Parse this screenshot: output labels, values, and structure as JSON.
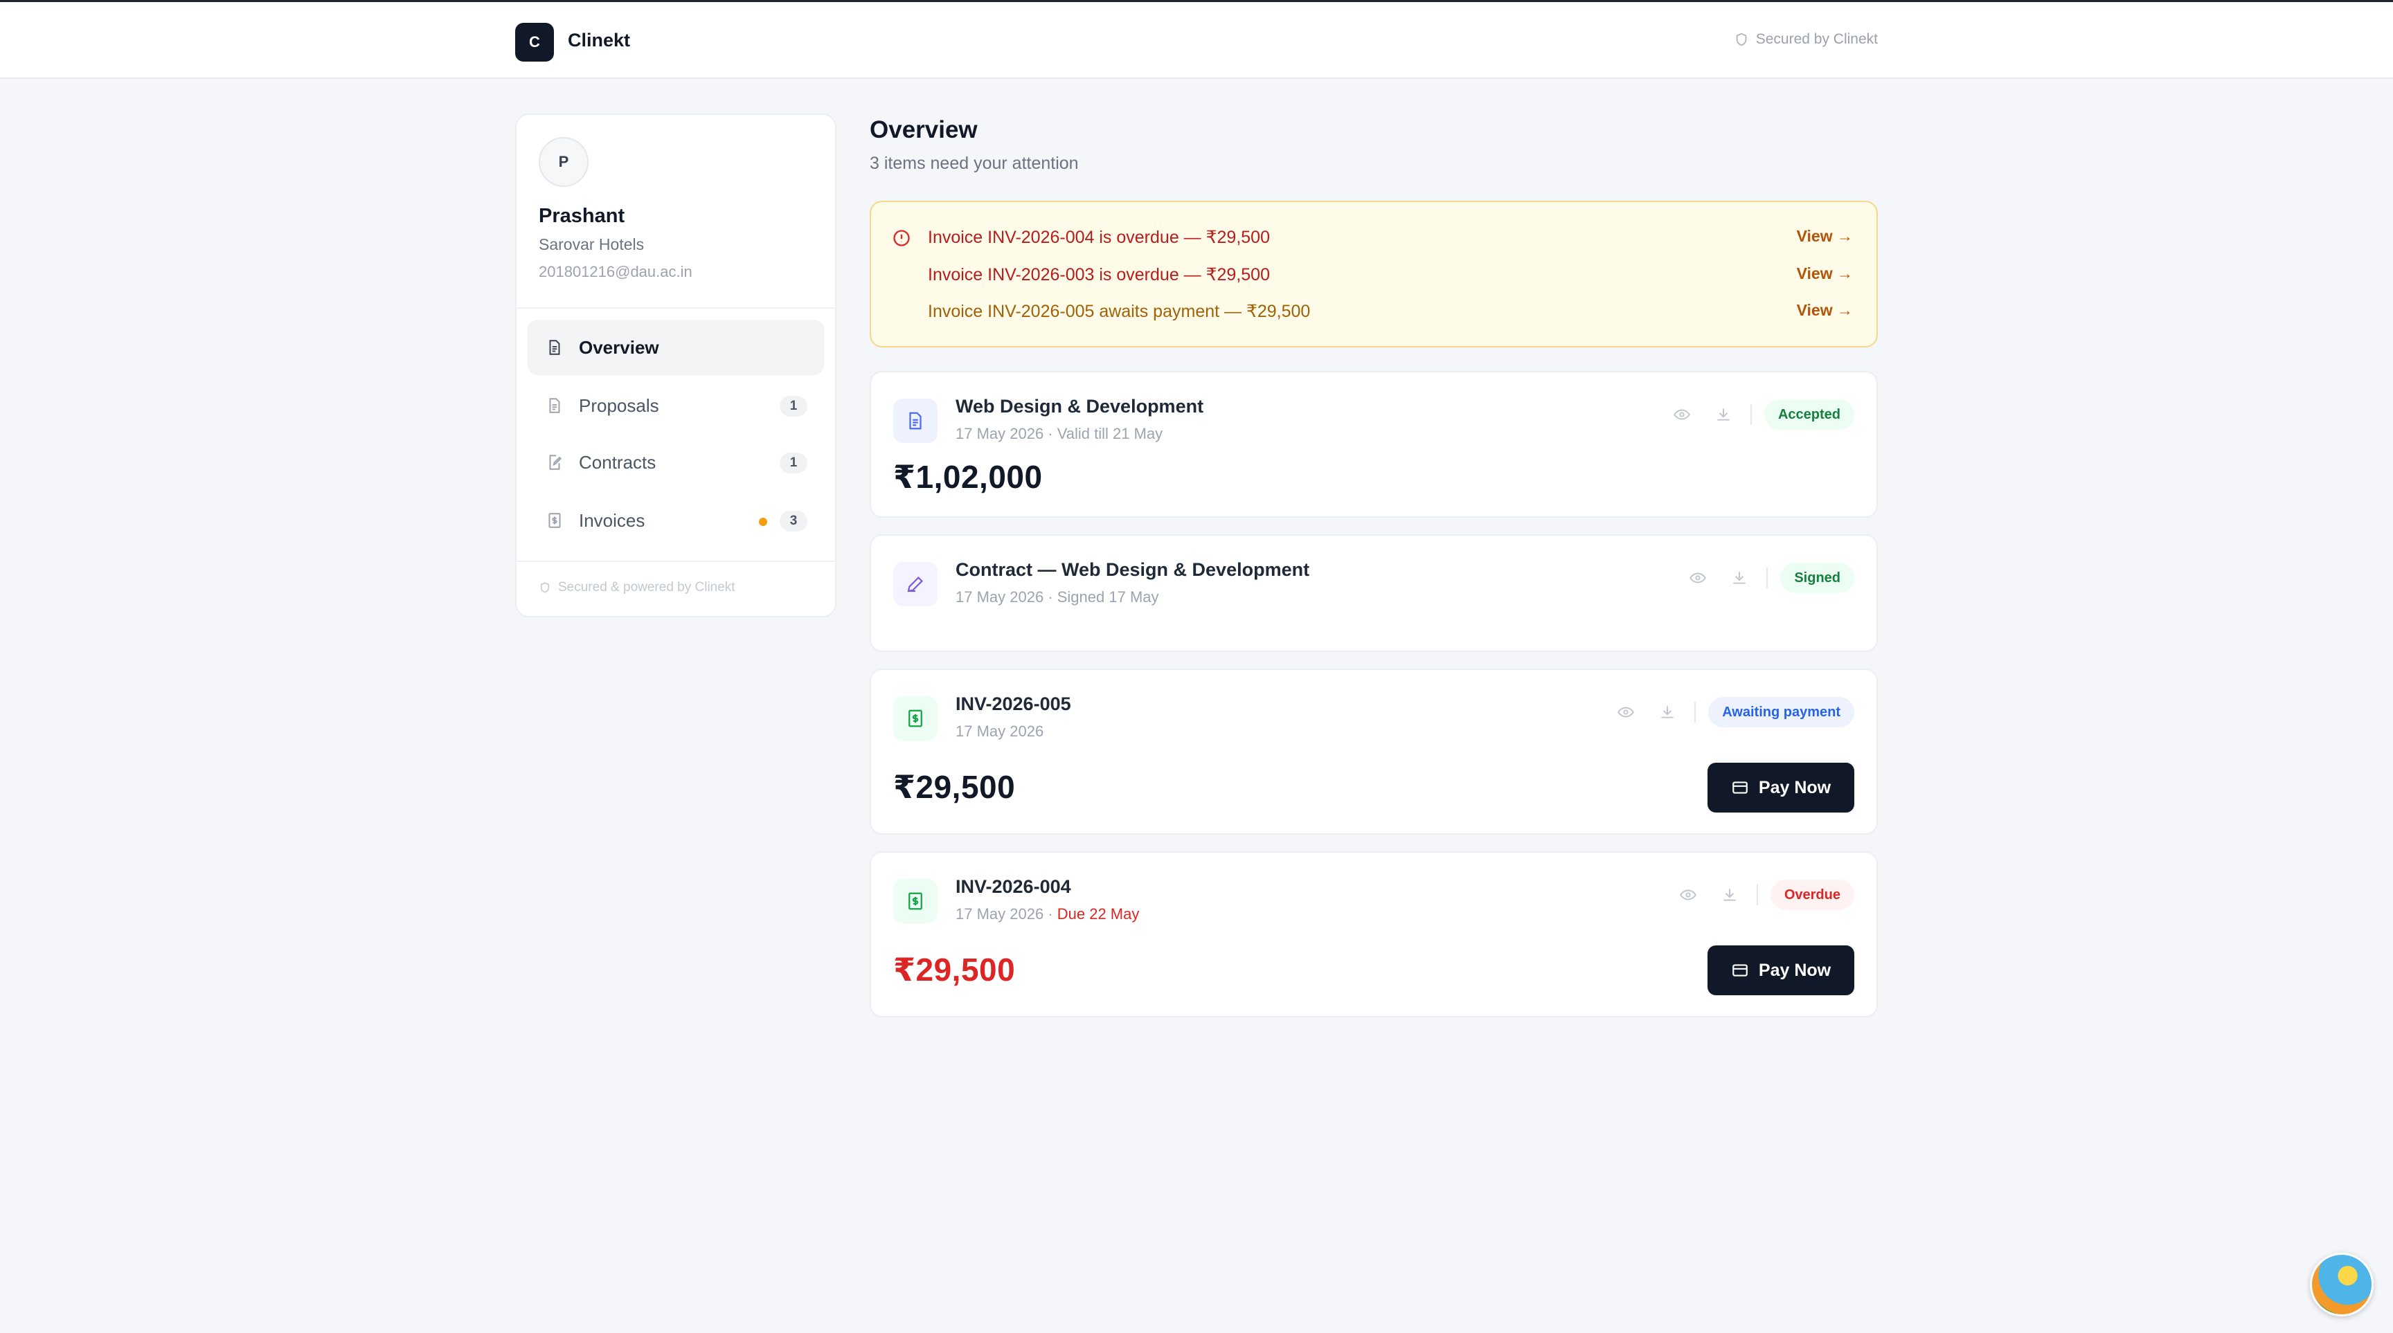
{
  "app": {
    "logo_letter": "C",
    "brand": "Clinekt",
    "secured_label": "Secured by Clinekt"
  },
  "profile": {
    "avatar_initial": "P",
    "name": "Prashant",
    "company": "Sarovar Hotels",
    "email": "201801216@dau.ac.in"
  },
  "nav": {
    "items": [
      {
        "label": "Overview",
        "icon": "document-icon",
        "active": true
      },
      {
        "label": "Proposals",
        "icon": "document-icon",
        "badge": "1"
      },
      {
        "label": "Contracts",
        "icon": "edit-document-icon",
        "badge": "1"
      },
      {
        "label": "Invoices",
        "icon": "receipt-icon",
        "badge": "3",
        "dot": true
      }
    ],
    "footer": "Secured & powered by Clinekt"
  },
  "overview": {
    "title": "Overview",
    "subtitle": "3 items need your attention"
  },
  "alerts": [
    {
      "text": "Invoice INV-2026-004 is overdue — ₹29,500",
      "action": "View →",
      "tone": "red"
    },
    {
      "text": "Invoice INV-2026-003 is overdue — ₹29,500",
      "action": "View →",
      "tone": "red"
    },
    {
      "text": "Invoice INV-2026-005 awaits payment — ₹29,500",
      "action": "View →",
      "tone": "amber"
    }
  ],
  "cards": {
    "proposal": {
      "title": "Web Design & Development",
      "meta": "17 May 2026 · Valid till 21 May",
      "status": "Accepted",
      "amount": "₹1,02,000"
    },
    "contract": {
      "title": "Contract — Web Design & Development",
      "meta": "17 May 2026 · Signed 17 May",
      "status": "Signed"
    },
    "invoice5": {
      "title": "INV-2026-005",
      "meta": "17 May 2026",
      "status": "Awaiting payment",
      "amount": "₹29,500",
      "button": "Pay Now"
    },
    "invoice4": {
      "title": "INV-2026-004",
      "meta_date": "17 May 2026 · ",
      "meta_due": "Due 22 May",
      "status": "Overdue",
      "amount": "₹29,500",
      "button": "Pay Now"
    }
  },
  "colors": {
    "primary_dark": "#111827",
    "overdue_red": "#dc2626",
    "accepted_green": "#15803d",
    "awaiting_blue": "#2563eb",
    "alert_bg": "#fefbe8",
    "page_bg": "#f4f6fa"
  }
}
